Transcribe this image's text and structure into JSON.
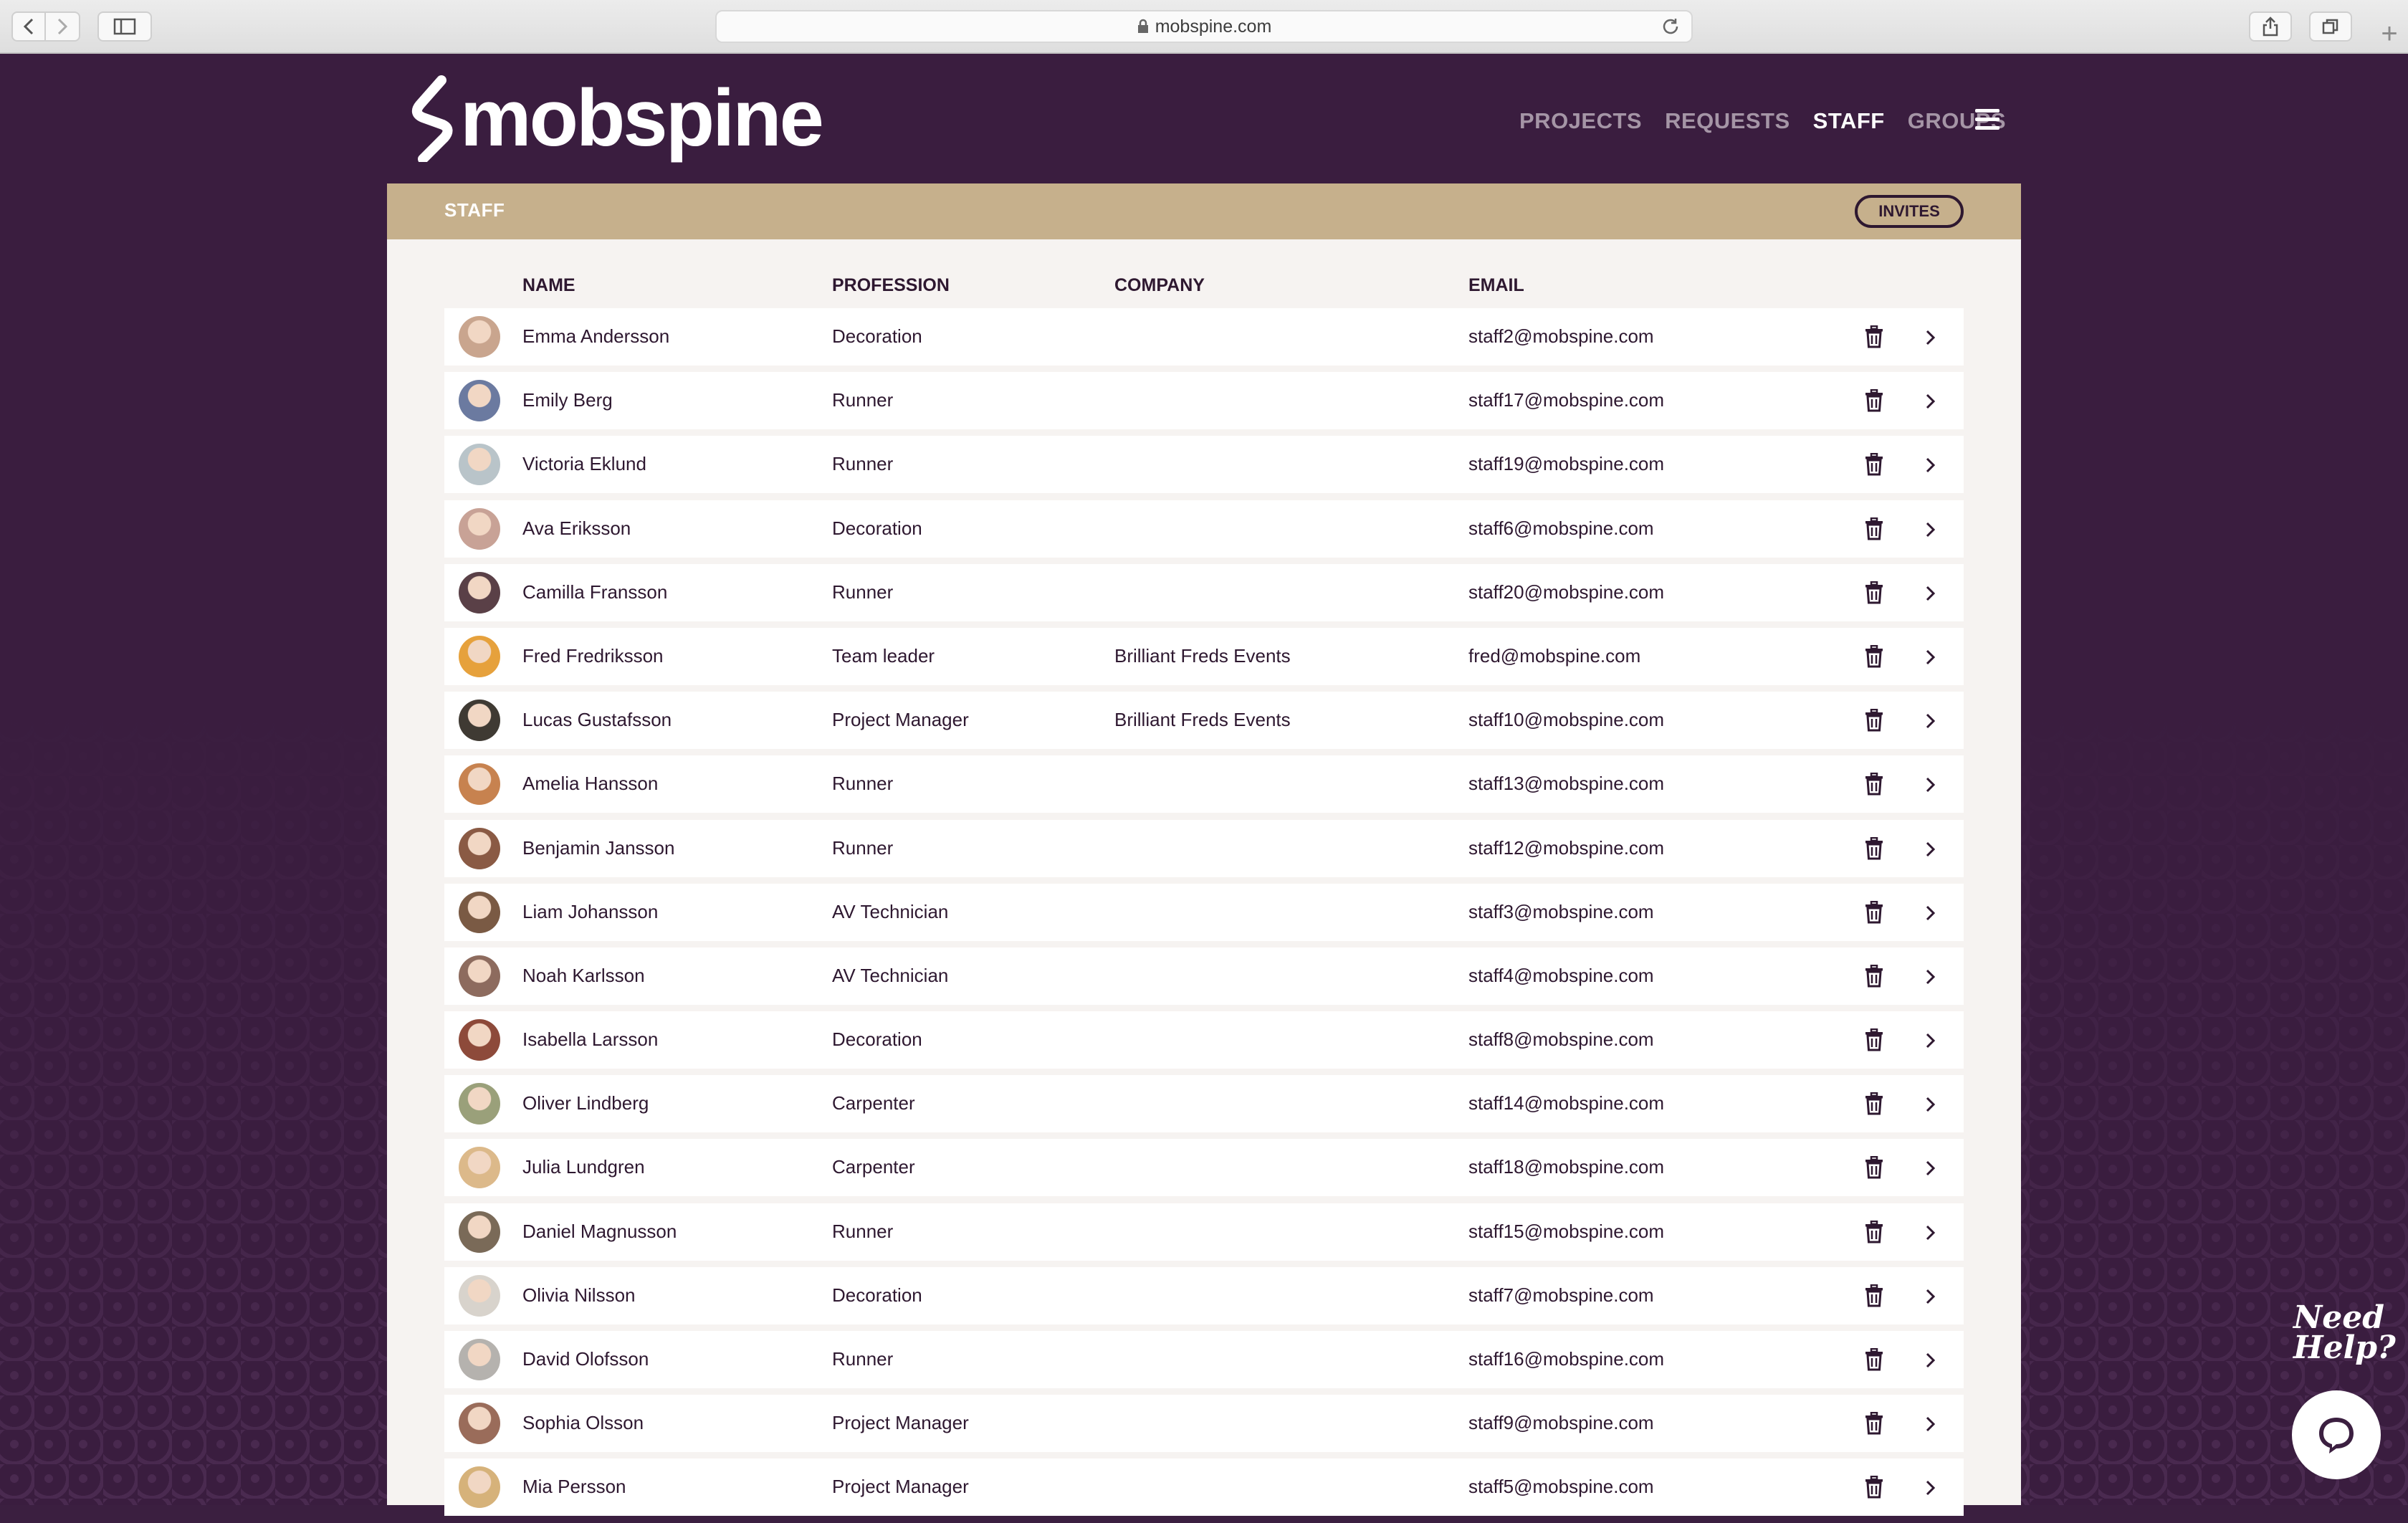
{
  "browser": {
    "url": "mobspine.com",
    "new_tab_symbol": "+"
  },
  "app": {
    "logo_text": "mobspine",
    "nav": [
      {
        "label": "PROJECTS",
        "active": false
      },
      {
        "label": "REQUESTS",
        "active": false
      },
      {
        "label": "STAFF",
        "active": true
      },
      {
        "label": "GROUPS",
        "active": false
      }
    ]
  },
  "panel": {
    "title": "STAFF",
    "invites_label": "INVITES"
  },
  "table": {
    "headers": {
      "name": "NAME",
      "profession": "PROFESSION",
      "company": "COMPANY",
      "email": "EMAIL"
    },
    "rows": [
      {
        "name": "Emma Andersson",
        "profession": "Decoration",
        "company": "",
        "email": "staff2@mobspine.com",
        "avatar_color": "#c9a58e"
      },
      {
        "name": "Emily Berg",
        "profession": "Runner",
        "company": "",
        "email": "staff17@mobspine.com",
        "avatar_color": "#6b7aa0"
      },
      {
        "name": "Victoria Eklund",
        "profession": "Runner",
        "company": "",
        "email": "staff19@mobspine.com",
        "avatar_color": "#b9c4c9"
      },
      {
        "name": "Ava Eriksson",
        "profession": "Decoration",
        "company": "",
        "email": "staff6@mobspine.com",
        "avatar_color": "#c8a296"
      },
      {
        "name": "Camilla Fransson",
        "profession": "Runner",
        "company": "",
        "email": "staff20@mobspine.com",
        "avatar_color": "#5a4047"
      },
      {
        "name": "Fred Fredriksson",
        "profession": "Team leader",
        "company": "Brilliant Freds Events",
        "email": "fred@mobspine.com",
        "avatar_color": "#e6a13c"
      },
      {
        "name": "Lucas Gustafsson",
        "profession": "Project Manager",
        "company": "Brilliant Freds Events",
        "email": "staff10@mobspine.com",
        "avatar_color": "#3f3a33"
      },
      {
        "name": "Amelia Hansson",
        "profession": "Runner",
        "company": "",
        "email": "staff13@mobspine.com",
        "avatar_color": "#c7824f"
      },
      {
        "name": "Benjamin Jansson",
        "profession": "Runner",
        "company": "",
        "email": "staff12@mobspine.com",
        "avatar_color": "#8a5a44"
      },
      {
        "name": "Liam Johansson",
        "profession": "AV Technician",
        "company": "",
        "email": "staff3@mobspine.com",
        "avatar_color": "#7a5a44"
      },
      {
        "name": "Noah Karlsson",
        "profession": "AV Technician",
        "company": "",
        "email": "staff4@mobspine.com",
        "avatar_color": "#8d6b5e"
      },
      {
        "name": "Isabella Larsson",
        "profession": "Decoration",
        "company": "",
        "email": "staff8@mobspine.com",
        "avatar_color": "#8d4a3a"
      },
      {
        "name": "Oliver Lindberg",
        "profession": "Carpenter",
        "company": "",
        "email": "staff14@mobspine.com",
        "avatar_color": "#9aa07a"
      },
      {
        "name": "Julia Lundgren",
        "profession": "Carpenter",
        "company": "",
        "email": "staff18@mobspine.com",
        "avatar_color": "#dcb98a"
      },
      {
        "name": "Daniel Magnusson",
        "profession": "Runner",
        "company": "",
        "email": "staff15@mobspine.com",
        "avatar_color": "#7a6a58"
      },
      {
        "name": "Olivia Nilsson",
        "profession": "Decoration",
        "company": "",
        "email": "staff7@mobspine.com",
        "avatar_color": "#d8d3cc"
      },
      {
        "name": "David Olofsson",
        "profession": "Runner",
        "company": "",
        "email": "staff16@mobspine.com",
        "avatar_color": "#b5b2ae"
      },
      {
        "name": "Sophia Olsson",
        "profession": "Project Manager",
        "company": "",
        "email": "staff9@mobspine.com",
        "avatar_color": "#9a6c5a"
      },
      {
        "name": "Mia Persson",
        "profession": "Project Manager",
        "company": "",
        "email": "staff5@mobspine.com",
        "avatar_color": "#d6b27a"
      }
    ]
  },
  "help": {
    "line1": "Need",
    "line2": "Help?"
  },
  "colors": {
    "brand_dark": "#3b1f40",
    "panel_header": "#c6b08c",
    "text_dark": "#2e1830"
  },
  "icons": [
    "back-icon",
    "forward-icon",
    "sidebar-icon",
    "lock-icon",
    "reload-icon",
    "share-icon",
    "tabs-icon",
    "hamburger-icon",
    "trash-icon",
    "chevron-right-icon",
    "chat-icon"
  ]
}
